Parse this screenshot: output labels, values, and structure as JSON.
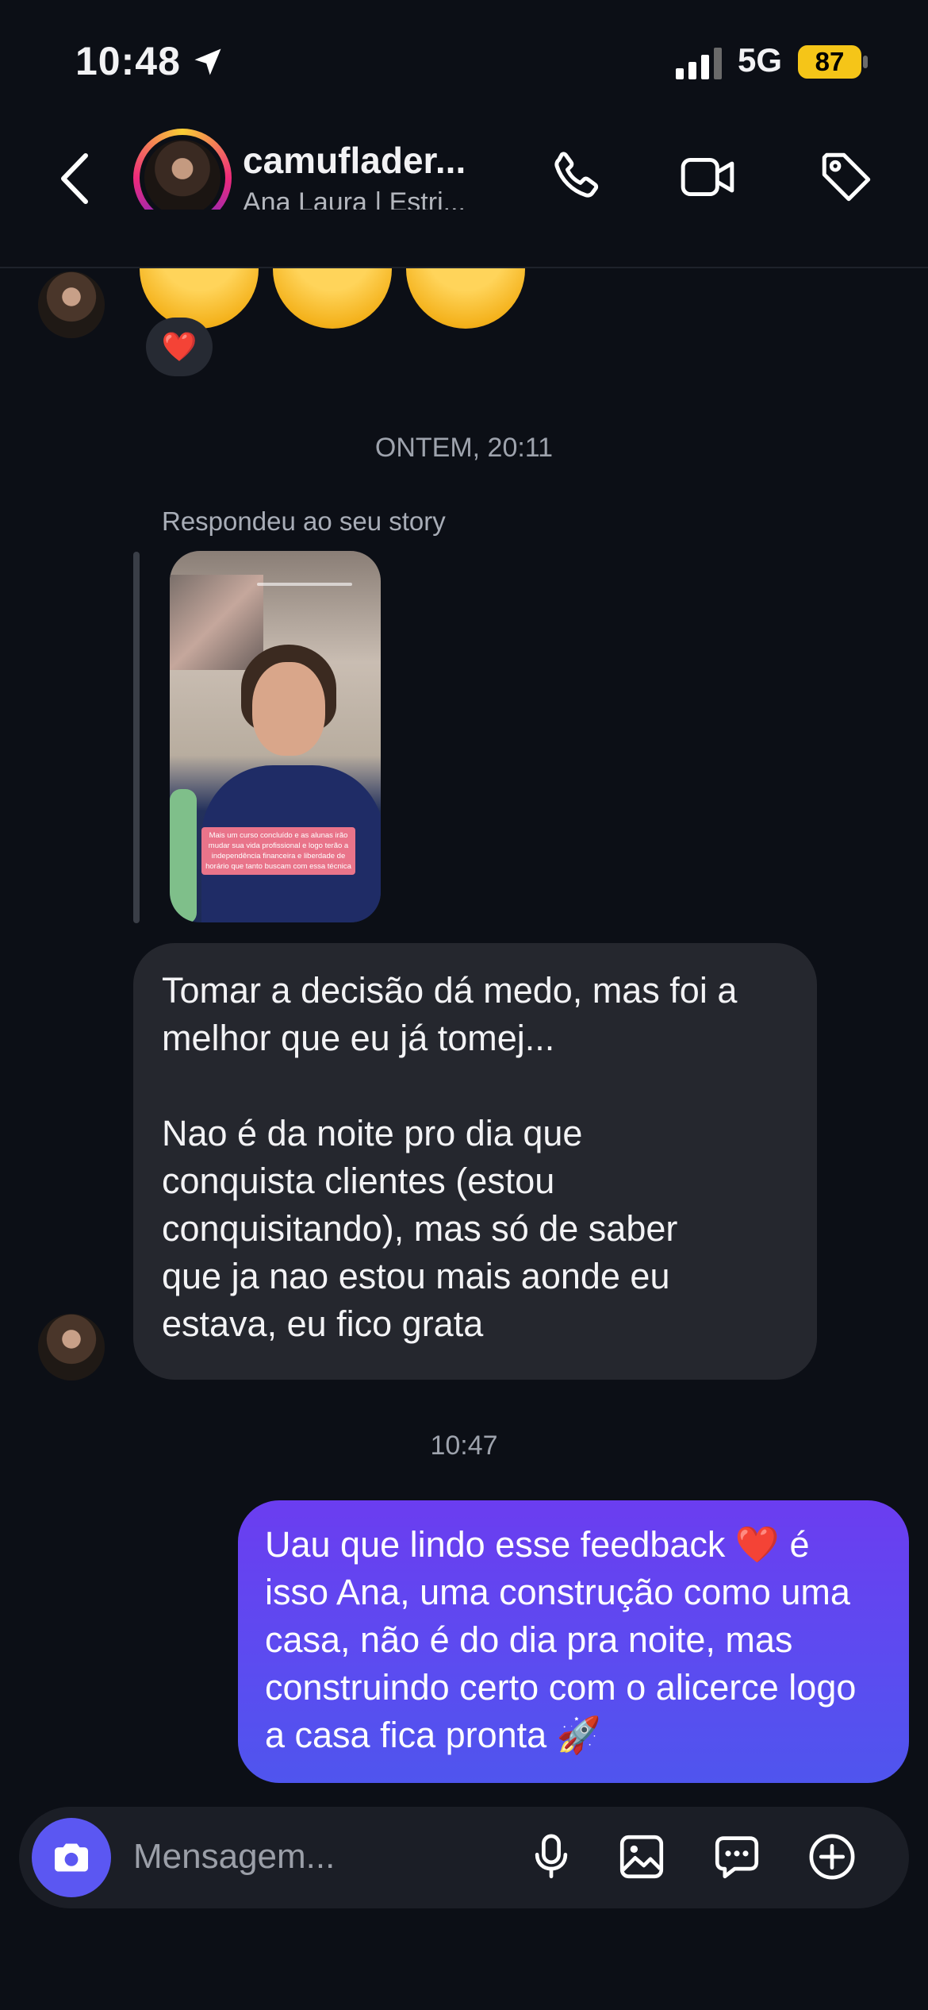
{
  "status_bar": {
    "time": "10:48",
    "network": "5G",
    "battery": "87"
  },
  "header": {
    "username": "camuflader...",
    "subtitle": "Ana Laura | Estri..."
  },
  "conversation": {
    "reaction": "❤️",
    "timestamp_1": "ONTEM, 20:11",
    "story_reply_label": "Respondeu ao seu story",
    "story_caption": "Mais um curso concluído e as alunas irão mudar sua vida profissional e logo terão a independência financeira e liberdade de horário que tanto buscam com essa técnica",
    "incoming_message": "Tomar a decisão dá medo, mas foi a\nmelhor que eu já tomej...\n\nNao é da noite pro dia que\nconquista clientes (estou\nconquisitando), mas só de saber\nque ja nao estou mais aonde eu\nestava, eu fico grata",
    "timestamp_2": "10:47",
    "outgoing_message": "Uau que lindo esse feedback ❤️  é isso Ana, uma construção como uma casa, não é do dia pra noite, mas construindo certo com o alicerce logo a casa fica pronta 🚀"
  },
  "composer": {
    "placeholder": "Mensagem..."
  }
}
